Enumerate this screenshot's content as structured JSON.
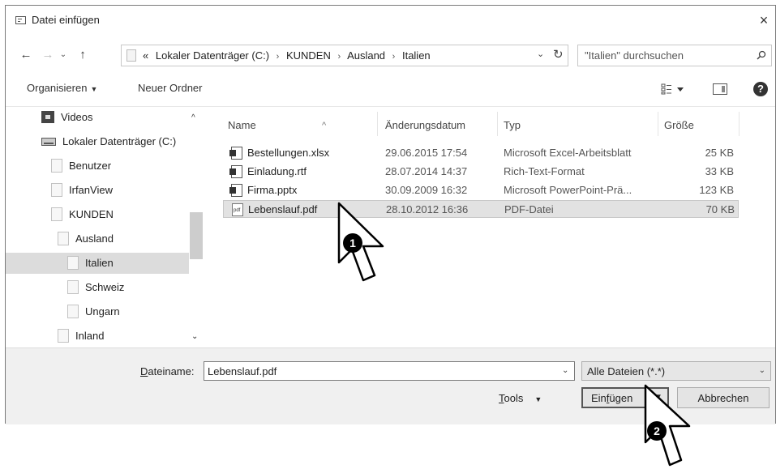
{
  "window": {
    "title": "Datei einfügen",
    "close": "×"
  },
  "nav": {
    "back": "←",
    "forward": "→",
    "history": "⌄",
    "up": "↑",
    "breadcrumb_prefix": "«",
    "breadcrumbs": [
      "Lokaler Datenträger (C:)",
      "KUNDEN",
      "Ausland",
      "Italien"
    ],
    "separator": "›",
    "address_dropdown": "⌄",
    "refresh": "↻",
    "search_placeholder": "\"Italien\" durchsuchen"
  },
  "toolbar": {
    "organize": "Organisieren",
    "new_folder": "Neuer Ordner",
    "caret": "▼",
    "help": "?"
  },
  "sidebar": {
    "items": [
      {
        "label": "Videos",
        "icon": "video-icon"
      },
      {
        "label": "Lokaler Datenträger (C:)",
        "icon": "drive-icon"
      },
      {
        "label": "Benutzer",
        "icon": "folder-icon"
      },
      {
        "label": "IrfanView",
        "icon": "folder-icon"
      },
      {
        "label": "KUNDEN",
        "icon": "folder-icon"
      },
      {
        "label": "Ausland",
        "icon": "folder-icon"
      },
      {
        "label": "Italien",
        "icon": "folder-icon",
        "selected": true
      },
      {
        "label": "Schweiz",
        "icon": "folder-icon"
      },
      {
        "label": "Ungarn",
        "icon": "folder-icon"
      },
      {
        "label": "Inland",
        "icon": "folder-icon"
      }
    ],
    "scroll_up": "^",
    "scroll_down": "⌄"
  },
  "files": {
    "columns": {
      "name": "Name",
      "modified": "Änderungsdatum",
      "type": "Typ",
      "size": "Größe",
      "sort_indicator": "^"
    },
    "rows": [
      {
        "name": "Bestellungen.xlsx",
        "modified": "29.06.2015 17:54",
        "type": "Microsoft Excel-Arbeitsblatt",
        "size": "25 KB",
        "icon": "excel-file-icon"
      },
      {
        "name": "Einladung.rtf",
        "modified": "28.07.2014 14:37",
        "type": "Rich-Text-Format",
        "size": "33 KB",
        "icon": "word-file-icon"
      },
      {
        "name": "Firma.pptx",
        "modified": "30.09.2009 16:32",
        "type": "Microsoft PowerPoint-Prä...",
        "size": "123 KB",
        "icon": "powerpoint-file-icon"
      },
      {
        "name": "Lebenslauf.pdf",
        "modified": "28.10.2012 16:36",
        "type": "PDF-Datei",
        "size": "70 KB",
        "icon": "pdf-file-icon",
        "selected": true
      }
    ]
  },
  "footer": {
    "filename_label_ul": "D",
    "filename_label_rest": "ateiname:",
    "filename_value": "Lebenslauf.pdf",
    "dropdown_caret": "⌄",
    "filter": "Alle Dateien (*.*)",
    "tools_ul": "T",
    "tools_rest": "ools",
    "tools_caret": "▼",
    "insert_pre": "Ein",
    "insert_ul": "f",
    "insert_post": "ügen",
    "insert_caret": "▼",
    "cancel": "Abbrechen"
  },
  "callouts": {
    "step1": "1",
    "step2": "2"
  }
}
